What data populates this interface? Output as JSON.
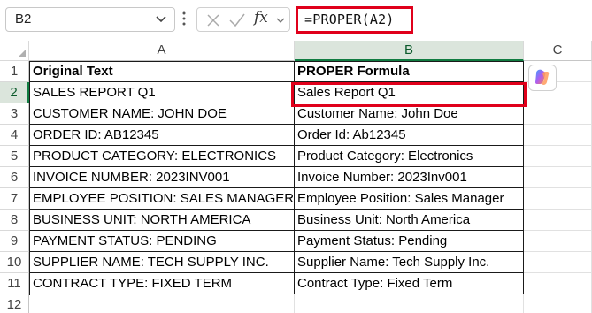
{
  "name_box": {
    "value": "B2",
    "dropdown_icon": "chevron-down-icon"
  },
  "formula_bar": {
    "more_icon": "vertical-ellipsis-icon",
    "cancel_icon": "close-icon",
    "enter_icon": "check-icon",
    "function_icon": "fx-icon",
    "function_label": "fx",
    "formula": "=PROPER(A2)"
  },
  "columns": [
    "A",
    "B",
    "C"
  ],
  "selected_column": "B",
  "selected_row": "2",
  "rows": [
    {
      "num": "1",
      "a": "Original Text",
      "b": "PROPER Formula"
    },
    {
      "num": "2",
      "a": "SALES REPORT Q1",
      "b": "Sales Report Q1"
    },
    {
      "num": "3",
      "a": "CUSTOMER NAME: JOHN DOE",
      "b": "Customer Name: John Doe"
    },
    {
      "num": "4",
      "a": "ORDER ID: AB12345",
      "b": "Order Id: Ab12345"
    },
    {
      "num": "5",
      "a": "PRODUCT CATEGORY: ELECTRONICS",
      "b": "Product Category: Electronics"
    },
    {
      "num": "6",
      "a": "INVOICE NUMBER: 2023INV001",
      "b": "Invoice Number: 2023Inv001"
    },
    {
      "num": "7",
      "a": "EMPLOYEE POSITION: SALES MANAGER",
      "b": "Employee Position: Sales Manager"
    },
    {
      "num": "8",
      "a": "BUSINESS UNIT: NORTH AMERICA",
      "b": "Business Unit: North America"
    },
    {
      "num": "9",
      "a": "PAYMENT STATUS: PENDING",
      "b": "Payment Status: Pending"
    },
    {
      "num": "10",
      "a": "SUPPLIER NAME: TECH SUPPLY INC.",
      "b": "Supplier Name: Tech Supply Inc."
    },
    {
      "num": "11",
      "a": "CONTRACT TYPE: FIXED TERM",
      "b": "Contract Type: Fixed Term"
    },
    {
      "num": "12",
      "a": "",
      "b": ""
    }
  ],
  "copilot": {
    "icon": "copilot-icon"
  },
  "colors": {
    "highlight_red": "#e0001b",
    "selection_green": "#107c41",
    "header_selected_bg": "#dbe5dc"
  }
}
